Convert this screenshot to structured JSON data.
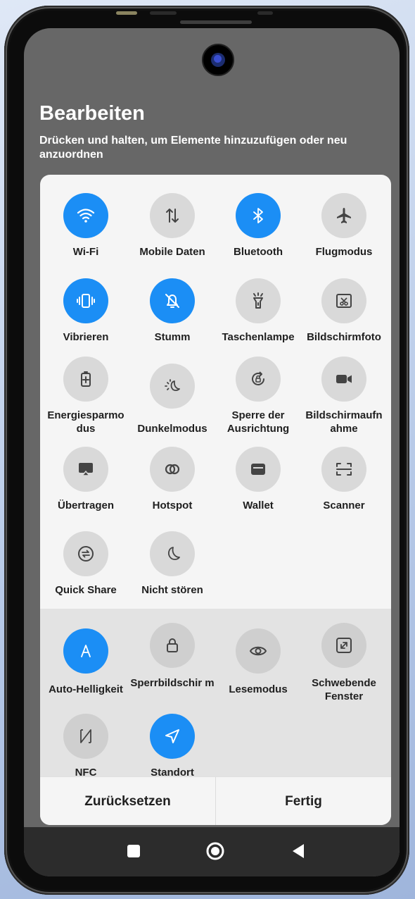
{
  "header": {
    "title": "Bearbeiten",
    "subtitle": "Drücken und halten, um Elemente hinzuzufügen oder neu anzuordnen"
  },
  "active_tiles": [
    {
      "label": "Wi-Fi",
      "icon": "wifi-icon",
      "active": true
    },
    {
      "label": "Mobile Daten",
      "icon": "mobile-data-icon",
      "active": false
    },
    {
      "label": "Bluetooth",
      "icon": "bluetooth-icon",
      "active": true
    },
    {
      "label": "Flugmodus",
      "icon": "airplane-icon",
      "active": false
    },
    {
      "label": "Vibrieren",
      "icon": "vibrate-icon",
      "active": true
    },
    {
      "label": "Stumm",
      "icon": "bell-off-icon",
      "active": true
    },
    {
      "label": "Taschenlampe",
      "icon": "flashlight-icon",
      "active": false
    },
    {
      "label": "Bildschirmfoto",
      "icon": "screenshot-icon",
      "active": false
    },
    {
      "label": "Energiesparmo dus",
      "icon": "battery-saver-icon",
      "active": false
    },
    {
      "label": "Dunkelmodus",
      "icon": "dark-mode-icon",
      "active": false
    },
    {
      "label": "Sperre der Ausrichtung",
      "icon": "rotation-lock-icon",
      "active": false
    },
    {
      "label": "Bildschirmaufn ahme",
      "icon": "screen-record-icon",
      "active": false
    },
    {
      "label": "Übertragen",
      "icon": "cast-icon",
      "active": false
    },
    {
      "label": "Hotspot",
      "icon": "hotspot-icon",
      "active": false
    },
    {
      "label": "Wallet",
      "icon": "wallet-icon",
      "active": false
    },
    {
      "label": "Scanner",
      "icon": "scanner-icon",
      "active": false
    },
    {
      "label": "Quick Share",
      "icon": "quick-share-icon",
      "active": false
    },
    {
      "label": "Nicht stören",
      "icon": "do-not-disturb-icon",
      "active": false
    }
  ],
  "available_tiles": [
    {
      "label": "Auto-Helligkeit",
      "icon": "auto-brightness-icon",
      "active": true
    },
    {
      "label": "Sperrbildschir m",
      "icon": "lock-icon",
      "active": false
    },
    {
      "label": "Lesemodus",
      "icon": "eye-icon",
      "active": false
    },
    {
      "label": "Schwebende Fenster",
      "icon": "floating-window-icon",
      "active": false
    },
    {
      "label": "NFC",
      "icon": "nfc-icon",
      "active": false
    },
    {
      "label": "Standort",
      "icon": "location-icon",
      "active": true
    }
  ],
  "footer": {
    "reset_label": "Zurücksetzen",
    "done_label": "Fertig"
  },
  "colors": {
    "accent": "#1b8ef5",
    "scrim": "#676767",
    "panel": "#f5f5f5",
    "tile_idle": "#d9d9d9"
  }
}
